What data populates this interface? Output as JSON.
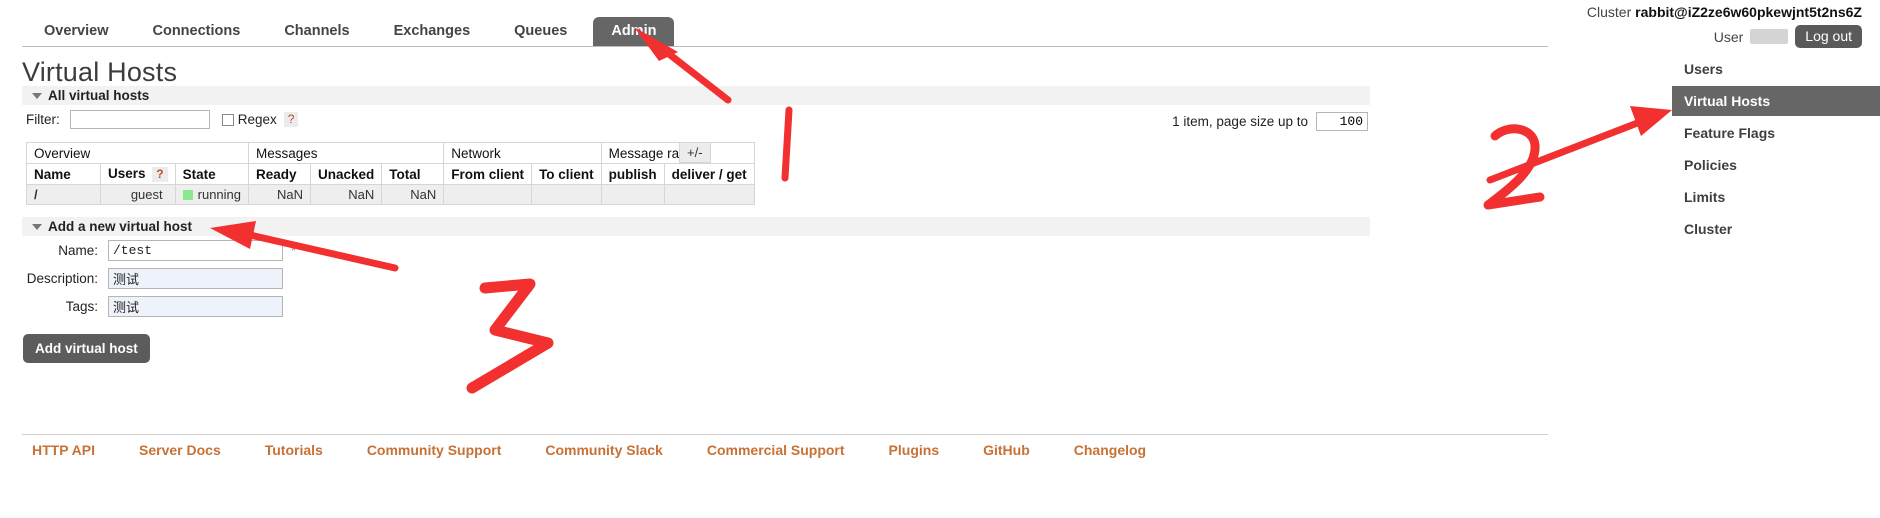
{
  "header": {
    "cluster_label": "Cluster",
    "cluster_name": "rabbit@iZ2ze6w60pkewjnt5t2ns6Z",
    "user_label": "User",
    "logout_label": "Log out"
  },
  "nav": {
    "tabs": [
      {
        "label": "Overview",
        "active": false
      },
      {
        "label": "Connections",
        "active": false
      },
      {
        "label": "Channels",
        "active": false
      },
      {
        "label": "Exchanges",
        "active": false
      },
      {
        "label": "Queues",
        "active": false
      },
      {
        "label": "Admin",
        "active": true
      }
    ]
  },
  "page": {
    "title": "Virtual Hosts"
  },
  "all_vhosts": {
    "section_title": "All virtual hosts",
    "filter_label": "Filter:",
    "filter_value": "",
    "filter_placeholder": "",
    "regex_label": "Regex",
    "help_glyph": "?",
    "paging_text": "1 item, page size up to",
    "page_size": "100",
    "plus_minus_label": "+/-",
    "group_headers": [
      "Overview",
      "Messages",
      "Network",
      "Message rates"
    ],
    "columns": [
      "Name",
      "Users",
      "State",
      "Ready",
      "Unacked",
      "Total",
      "From client",
      "To client",
      "publish",
      "deliver / get"
    ],
    "users_help": "?",
    "rows": [
      {
        "name": "/",
        "users": "guest",
        "state": "running",
        "state_color": "#8ce88c",
        "ready": "NaN",
        "unacked": "NaN",
        "total": "NaN",
        "from_client": "",
        "to_client": "",
        "publish": "",
        "deliver_get": ""
      }
    ]
  },
  "add_vhost": {
    "section_title": "Add a new virtual host",
    "fields": [
      {
        "label": "Name:",
        "value": "/test",
        "required": true,
        "mono": true
      },
      {
        "label": "Description:",
        "value": "测试",
        "required": false,
        "mono": false
      },
      {
        "label": "Tags:",
        "value": "测试",
        "required": false,
        "mono": false
      }
    ],
    "required_glyph": "*",
    "submit_label": "Add virtual host"
  },
  "sidebar": {
    "items": [
      {
        "label": "Users",
        "active": false
      },
      {
        "label": "Virtual Hosts",
        "active": true
      },
      {
        "label": "Feature Flags",
        "active": false
      },
      {
        "label": "Policies",
        "active": false
      },
      {
        "label": "Limits",
        "active": false
      },
      {
        "label": "Cluster",
        "active": false
      }
    ]
  },
  "footer": {
    "links": [
      "HTTP API",
      "Server Docs",
      "Tutorials",
      "Community Support",
      "Community Slack",
      "Commercial Support",
      "Plugins",
      "GitHub",
      "Changelog"
    ]
  },
  "annotations": {
    "color": "#f23030",
    "marks": [
      {
        "name": "step-1",
        "label": "1"
      },
      {
        "name": "step-2",
        "label": "2"
      },
      {
        "name": "step-3",
        "label": "3"
      }
    ]
  }
}
